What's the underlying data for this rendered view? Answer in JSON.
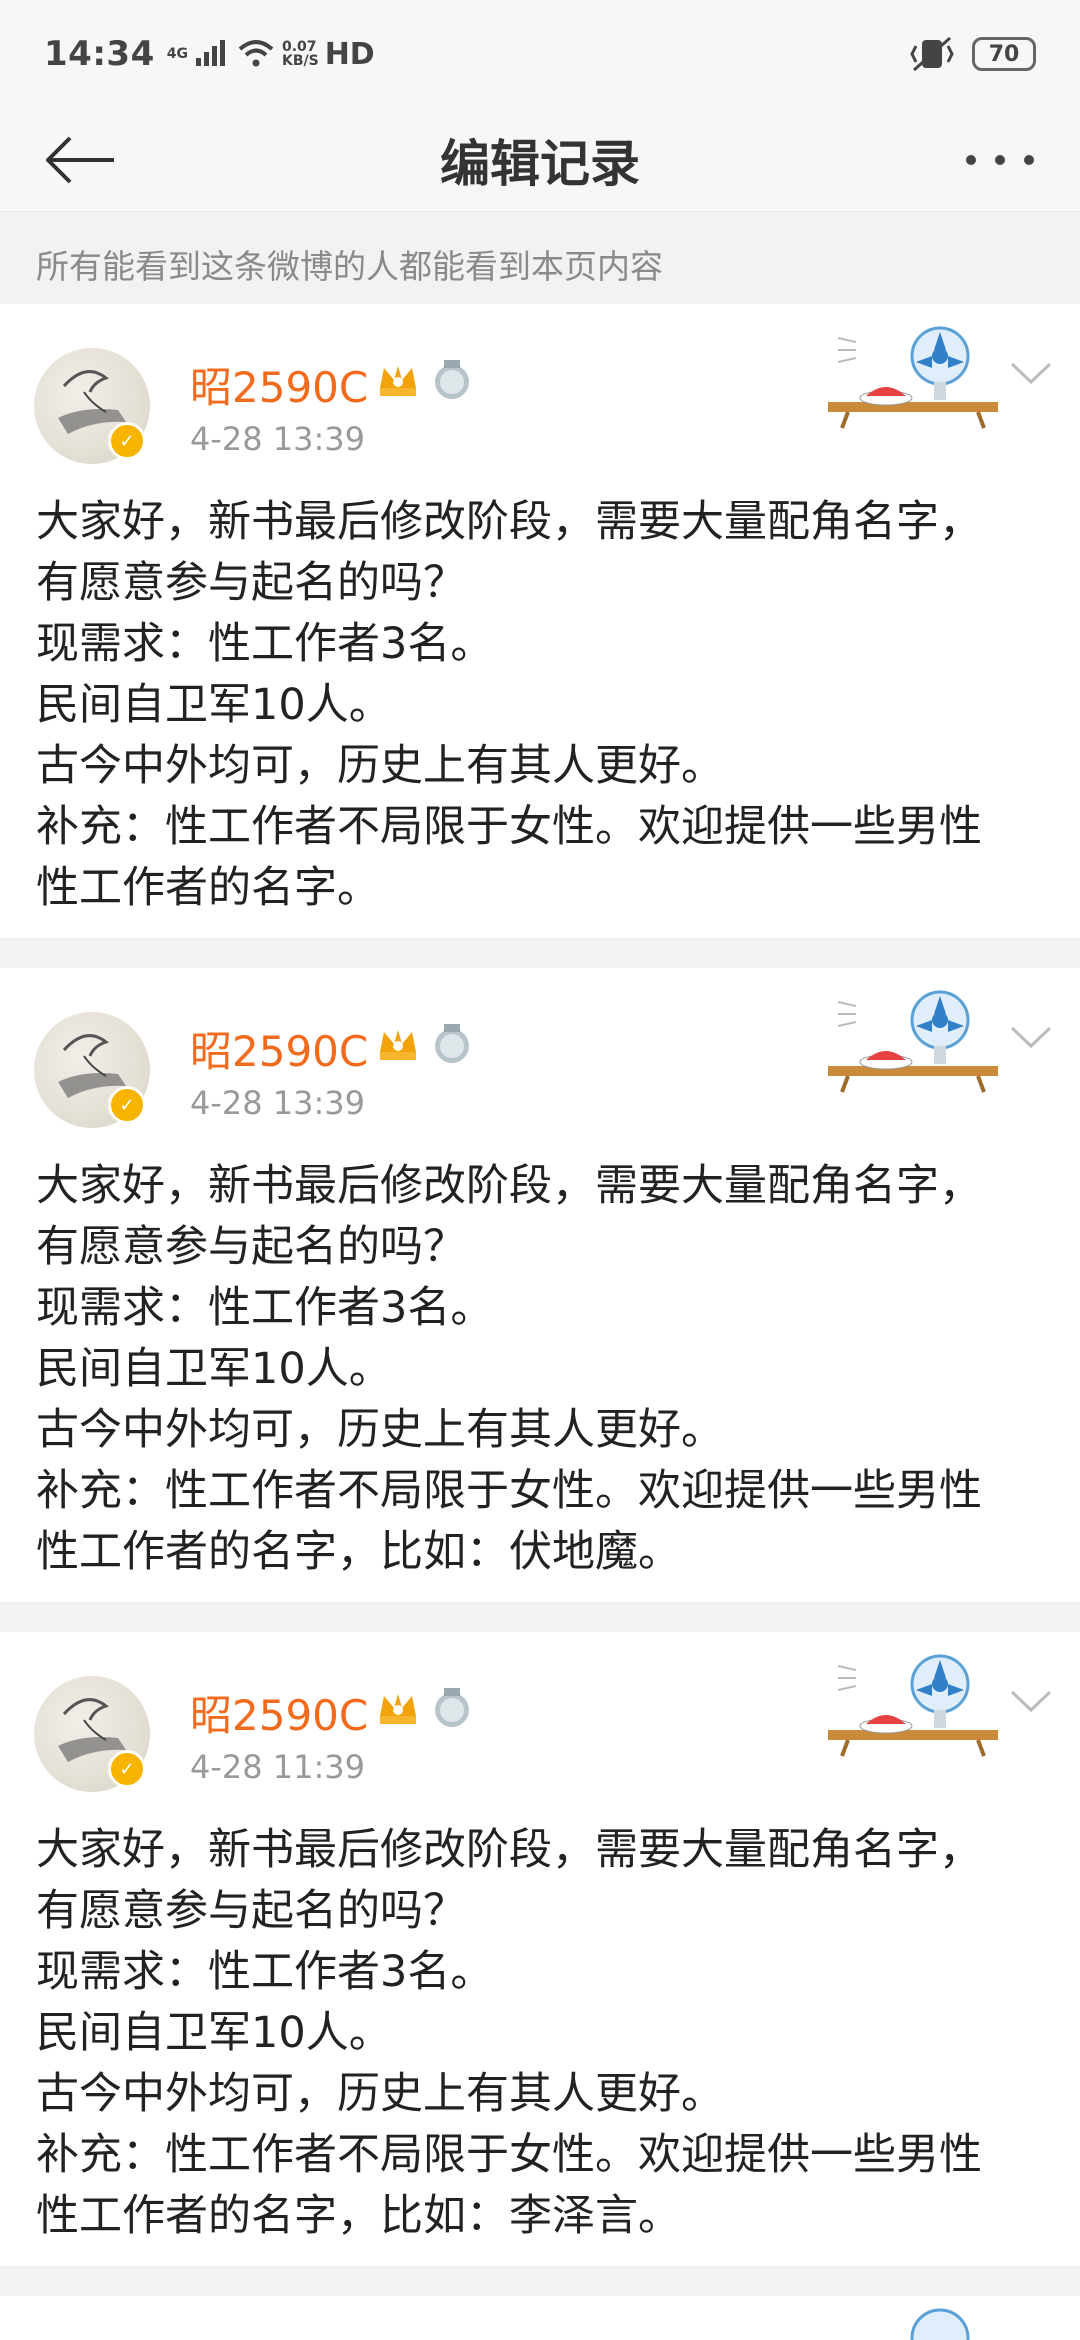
{
  "status_bar": {
    "time": "14:34",
    "network": "4G",
    "speed_value": "0.07",
    "speed_unit": "KB/S",
    "hd": "HD",
    "battery": "70"
  },
  "header": {
    "title": "编辑记录"
  },
  "notice": "所有能看到这条微博的人都能看到本页内容",
  "posts": [
    {
      "username": "昭2590C",
      "time": "4-28 13:39",
      "lines": [
        "大家好，新书最后修改阶段，需要大量配角名字，",
        "有愿意参与起名的吗？",
        "现需求：性工作者3名。",
        "民间自卫军10人。",
        "古今中外均可，历史上有其人更好。",
        "补充：性工作者不局限于女性。欢迎提供一些男性",
        "性工作者的名字。"
      ]
    },
    {
      "username": "昭2590C",
      "time": "4-28 13:39",
      "lines": [
        "大家好，新书最后修改阶段，需要大量配角名字，",
        "有愿意参与起名的吗？",
        "现需求：性工作者3名。",
        "民间自卫军10人。",
        "古今中外均可，历史上有其人更好。",
        "补充：性工作者不局限于女性。欢迎提供一些男性",
        "性工作者的名字，比如：伏地魔。"
      ]
    },
    {
      "username": "昭2590C",
      "time": "4-28 11:39",
      "lines": [
        "大家好，新书最后修改阶段，需要大量配角名字，",
        "有愿意参与起名的吗？",
        "现需求：性工作者3名。",
        "民间自卫军10人。",
        "古今中外均可，历史上有其人更好。",
        "补充：性工作者不局限于女性。欢迎提供一些男性",
        "性工作者的名字，比如：李泽言。"
      ]
    }
  ],
  "colors": {
    "username": "#f26b1d",
    "background": "#f2f2f2",
    "card": "#ffffff",
    "muted": "#999999"
  },
  "icons": [
    "back-arrow-icon",
    "more-dots-icon",
    "verified-icon",
    "crown-icon",
    "medal-icon",
    "fan-decor-icon",
    "chevron-down-icon"
  ]
}
